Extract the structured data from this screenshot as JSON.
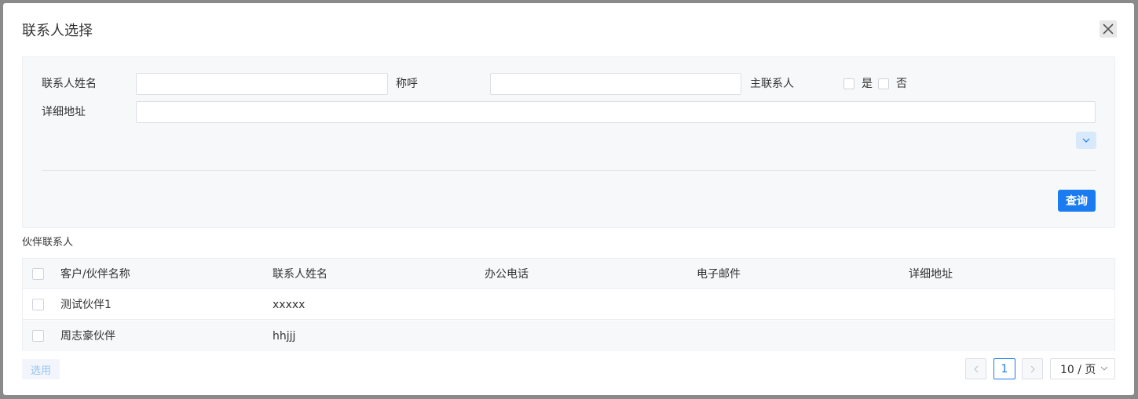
{
  "dialog": {
    "title": "联系人选择"
  },
  "search": {
    "contact_name_label": "联系人姓名",
    "contact_name_value": "",
    "salutation_label": "称呼",
    "salutation_value": "",
    "primary_contact_label": "主联系人",
    "option_yes": "是",
    "option_no": "否",
    "address_label": "详细地址",
    "address_value": "",
    "query_label": "查询"
  },
  "section": {
    "title": "伙伴联系人"
  },
  "table": {
    "columns": [
      "客户/伙伴名称",
      "联系人姓名",
      "办公电话",
      "电子邮件",
      "详细地址"
    ],
    "rows": [
      {
        "partner": "测试伙伴1",
        "contact": "xxxxx",
        "phone": "",
        "email": "",
        "address": ""
      },
      {
        "partner": "周志豪伙伴",
        "contact": "hhjjj",
        "phone": "",
        "email": "",
        "address": ""
      }
    ]
  },
  "footer": {
    "select_label": "选用",
    "current_page": "1",
    "page_size": "10 / 页"
  },
  "colors": {
    "primary": "#1a7cf0",
    "panel_bg": "#f7f8fa"
  }
}
